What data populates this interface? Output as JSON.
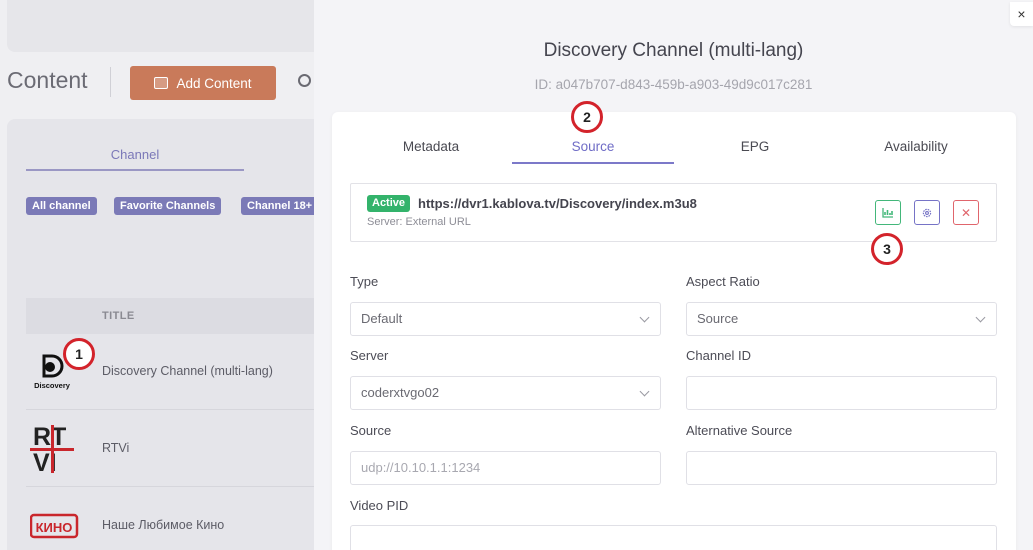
{
  "background": {
    "page_title": "Content",
    "add_button": "Add Content",
    "tab_channel": "Channel",
    "chips": [
      "All channel",
      "Favorite Channels",
      "Channel 18+"
    ],
    "table_header_title": "TITLE",
    "rows": [
      {
        "name": "Discovery Channel (multi-lang)",
        "logo_text": "Discovery"
      },
      {
        "name": "RTVi",
        "logo_text": "RTVI"
      },
      {
        "name": "Наше Любимое Кино",
        "logo_text": "КИНО"
      }
    ]
  },
  "markers": [
    "1",
    "2",
    "3"
  ],
  "modal": {
    "close_icon": "×",
    "title": "Discovery Channel (multi-lang)",
    "id_text": "ID: a047b707-d843-459b-a903-49d9c017c281",
    "tabs": [
      "Metadata",
      "Source",
      "EPG",
      "Availability"
    ],
    "active_tab": "Source",
    "source": {
      "status": "Active",
      "url": "https://dvr1.kablova.tv/Discovery/index.m3u8",
      "server": "Server: External URL",
      "actions": [
        "chart-icon",
        "gear-icon",
        "close-icon"
      ]
    },
    "fields": {
      "type_label": "Type",
      "type_value": "Default",
      "aspect_label": "Aspect Ratio",
      "aspect_value": "Source",
      "server_label": "Server",
      "server_value": "coderxtvgo02",
      "channel_id_label": "Channel ID",
      "channel_id_value": "",
      "source_label": "Source",
      "source_placeholder": "udp://10.10.1.1:1234",
      "alt_source_label": "Alternative Source",
      "alt_source_value": "",
      "video_pid_label": "Video PID",
      "video_pid_value": ""
    }
  },
  "colors": {
    "accent": "#6f6cc6",
    "active_badge": "#33b36b",
    "add_button": "#c97a5a",
    "marker_border": "#d3232b",
    "delete": "#e0656c"
  }
}
